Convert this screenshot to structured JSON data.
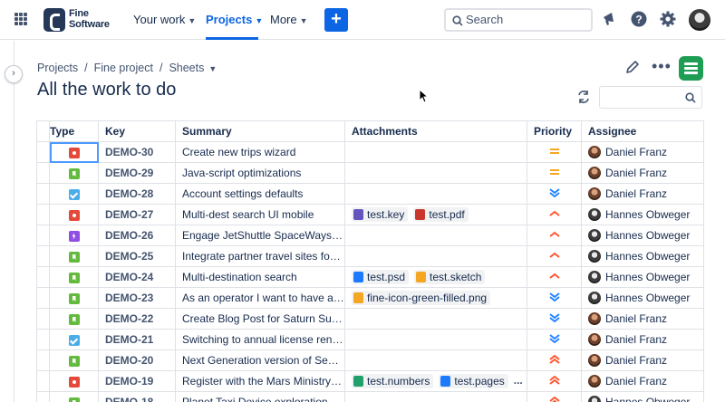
{
  "nav": {
    "brand_line1": "Fine",
    "brand_line2": "Software",
    "your_work": "Your work",
    "projects": "Projects",
    "more": "More",
    "create": "+",
    "search_placeholder": "Search"
  },
  "breadcrumbs": [
    "Projects",
    "Fine project",
    "Sheets"
  ],
  "page_title": "All the work to do",
  "columns": [
    "Type",
    "Key",
    "Summary",
    "Attachments",
    "Priority",
    "Assignee"
  ],
  "rows": [
    {
      "type": "bug",
      "key": "DEMO-30",
      "summary": "Create new trips wizard",
      "attachments": [],
      "priority": "medium",
      "assignee": "Daniel Franz",
      "avatar": "df"
    },
    {
      "type": "story",
      "key": "DEMO-29",
      "summary": "Java-script optimizations",
      "attachments": [],
      "priority": "medium",
      "assignee": "Daniel Franz",
      "avatar": "df"
    },
    {
      "type": "task",
      "key": "DEMO-28",
      "summary": "Account settings defaults",
      "attachments": [],
      "priority": "lowest",
      "assignee": "Daniel Franz",
      "avatar": "df"
    },
    {
      "type": "bug",
      "key": "DEMO-27",
      "summary": "Multi-dest search UI mobile",
      "attachments": [
        {
          "name": "test.key",
          "color": "#6554c0"
        },
        {
          "name": "test.pdf",
          "color": "#c9372c"
        }
      ],
      "priority": "high",
      "assignee": "Hannes Obweger",
      "avatar": "ho"
    },
    {
      "type": "epic",
      "key": "DEMO-26",
      "summary": "Engage JetShuttle SpaceWays fo...",
      "attachments": [],
      "priority": "high",
      "assignee": "Hannes Obweger",
      "avatar": "ho"
    },
    {
      "type": "story",
      "key": "DEMO-25",
      "summary": "Integrate partner travel sites foo ...",
      "attachments": [],
      "priority": "high",
      "assignee": "Hannes Obweger",
      "avatar": "ho"
    },
    {
      "type": "story",
      "key": "DEMO-24",
      "summary": "Multi-destination search",
      "attachments": [
        {
          "name": "test.psd",
          "color": "#1d7afc"
        },
        {
          "name": "test.sketch",
          "color": "#f5a623"
        }
      ],
      "priority": "high",
      "assignee": "Hannes Obweger",
      "avatar": "ho"
    },
    {
      "type": "story",
      "key": "DEMO-23",
      "summary": "As an operator I want to have a t...",
      "attachments": [
        {
          "name": "fine-icon-green-filled.png",
          "color": "#f5a623"
        }
      ],
      "priority": "lowest",
      "assignee": "Hannes Obweger",
      "avatar": "ho"
    },
    {
      "type": "story",
      "key": "DEMO-22",
      "summary": "Create Blog Post for Saturn Sum...",
      "attachments": [],
      "priority": "lowest",
      "assignee": "Daniel Franz",
      "avatar": "df"
    },
    {
      "type": "task",
      "key": "DEMO-21",
      "summary": "Switching to annual license rene...",
      "attachments": [],
      "priority": "lowest",
      "assignee": "Daniel Franz",
      "avatar": "df"
    },
    {
      "type": "story",
      "key": "DEMO-20",
      "summary": "Next Generation version of SeeS...",
      "attachments": [],
      "priority": "highest",
      "assignee": "Daniel Franz",
      "avatar": "df"
    },
    {
      "type": "bug",
      "key": "DEMO-19",
      "summary": "Register with the Mars Ministry o...",
      "attachments": [
        {
          "name": "test.numbers",
          "color": "#22a06b"
        },
        {
          "name": "test.pages",
          "color": "#1d7afc"
        },
        {
          "name": "...",
          "color": ""
        }
      ],
      "priority": "highest",
      "assignee": "Daniel Franz",
      "avatar": "df"
    },
    {
      "type": "story",
      "key": "DEMO-18",
      "summary": "Planet Taxi Device exploration &...",
      "attachments": [],
      "priority": "highest",
      "assignee": "Hannes Obweger",
      "avatar": "ho"
    }
  ],
  "colors": {
    "accent": "#0c66e4",
    "priority_medium": "#f5a623",
    "priority_low": "#2684ff",
    "priority_high": "#ff5630"
  }
}
